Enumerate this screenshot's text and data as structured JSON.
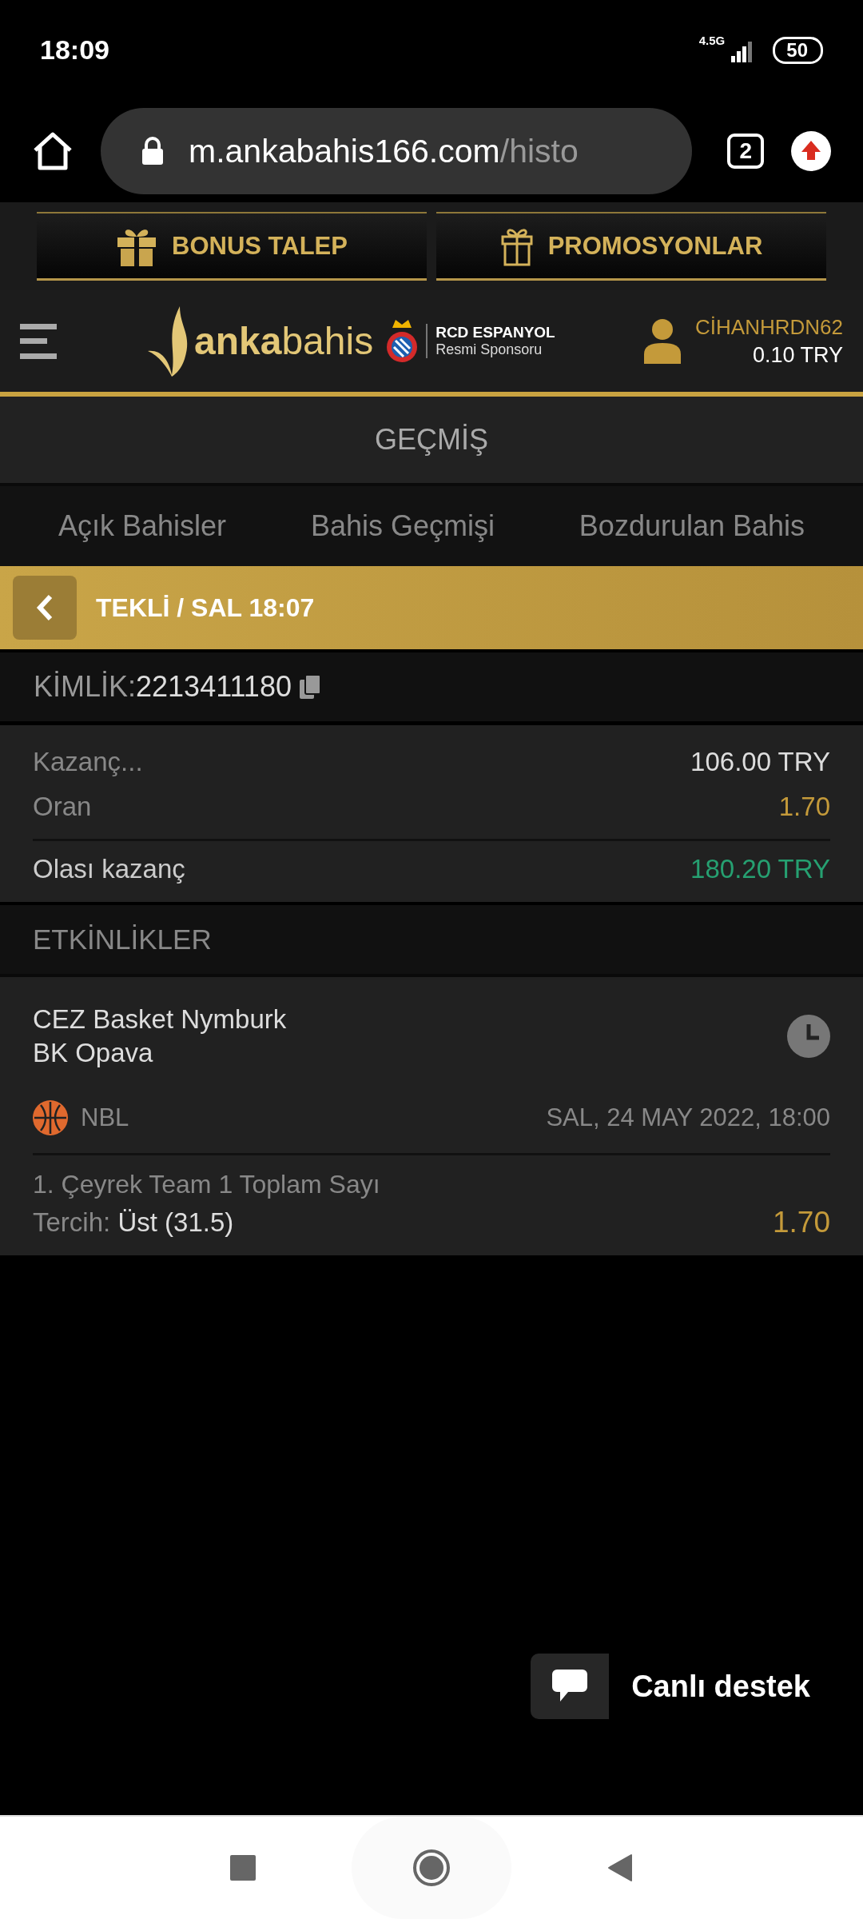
{
  "status_bar": {
    "time": "18:09",
    "network": "4.5G",
    "battery": "50"
  },
  "browser": {
    "url_host": "m.ankabahis166.com",
    "url_path": "/histo",
    "tab_count": "2"
  },
  "promo_buttons": [
    {
      "label": "BONUS TALEP",
      "kind": "gift-solid"
    },
    {
      "label": "PROMOSYONLAR",
      "kind": "gift-outline"
    }
  ],
  "header": {
    "logo": "**anka**bahis",
    "sponsor_title": "RCD ESPANYOL",
    "sponsor_subtitle": "Resmi Sponsoru",
    "username": "CİHANHRDN62",
    "balance": "0.10 TRY"
  },
  "page_title": "GEÇMİŞ",
  "tabs": [
    {
      "label": "Açık Bahisler",
      "selected": false
    },
    {
      "label": "Bahis Geçmişi",
      "selected": false
    },
    {
      "label": "Bozdurulan Bahis",
      "selected": false
    }
  ],
  "bet_header": "TEKLİ / SAL 18:07",
  "bet_id": {
    "label": "KİMLİK:",
    "value": "2213411180"
  },
  "summary": [
    {
      "label": "Kazanç...",
      "value": "106.00 TRY",
      "kind": "plain"
    },
    {
      "label": "Oran",
      "value": "1.70",
      "kind": "odds"
    },
    {
      "label": "Olası kazanç",
      "value": "180.20 TRY",
      "kind": "win"
    }
  ],
  "events_title": "ETKİNLİKLER",
  "events": [
    {
      "team_1": "CEZ Basket Nymburk",
      "team_2": "BK Opava",
      "league": "NBL",
      "date": "SAL, 24 MAY 2022, 18:00",
      "market": "1. Çeyrek Team 1 Toplam Sayı",
      "choice_label": "Tercih:",
      "choice": "Üst (31.5)",
      "odds": "1.70"
    }
  ],
  "support_label": "Canlı destek"
}
